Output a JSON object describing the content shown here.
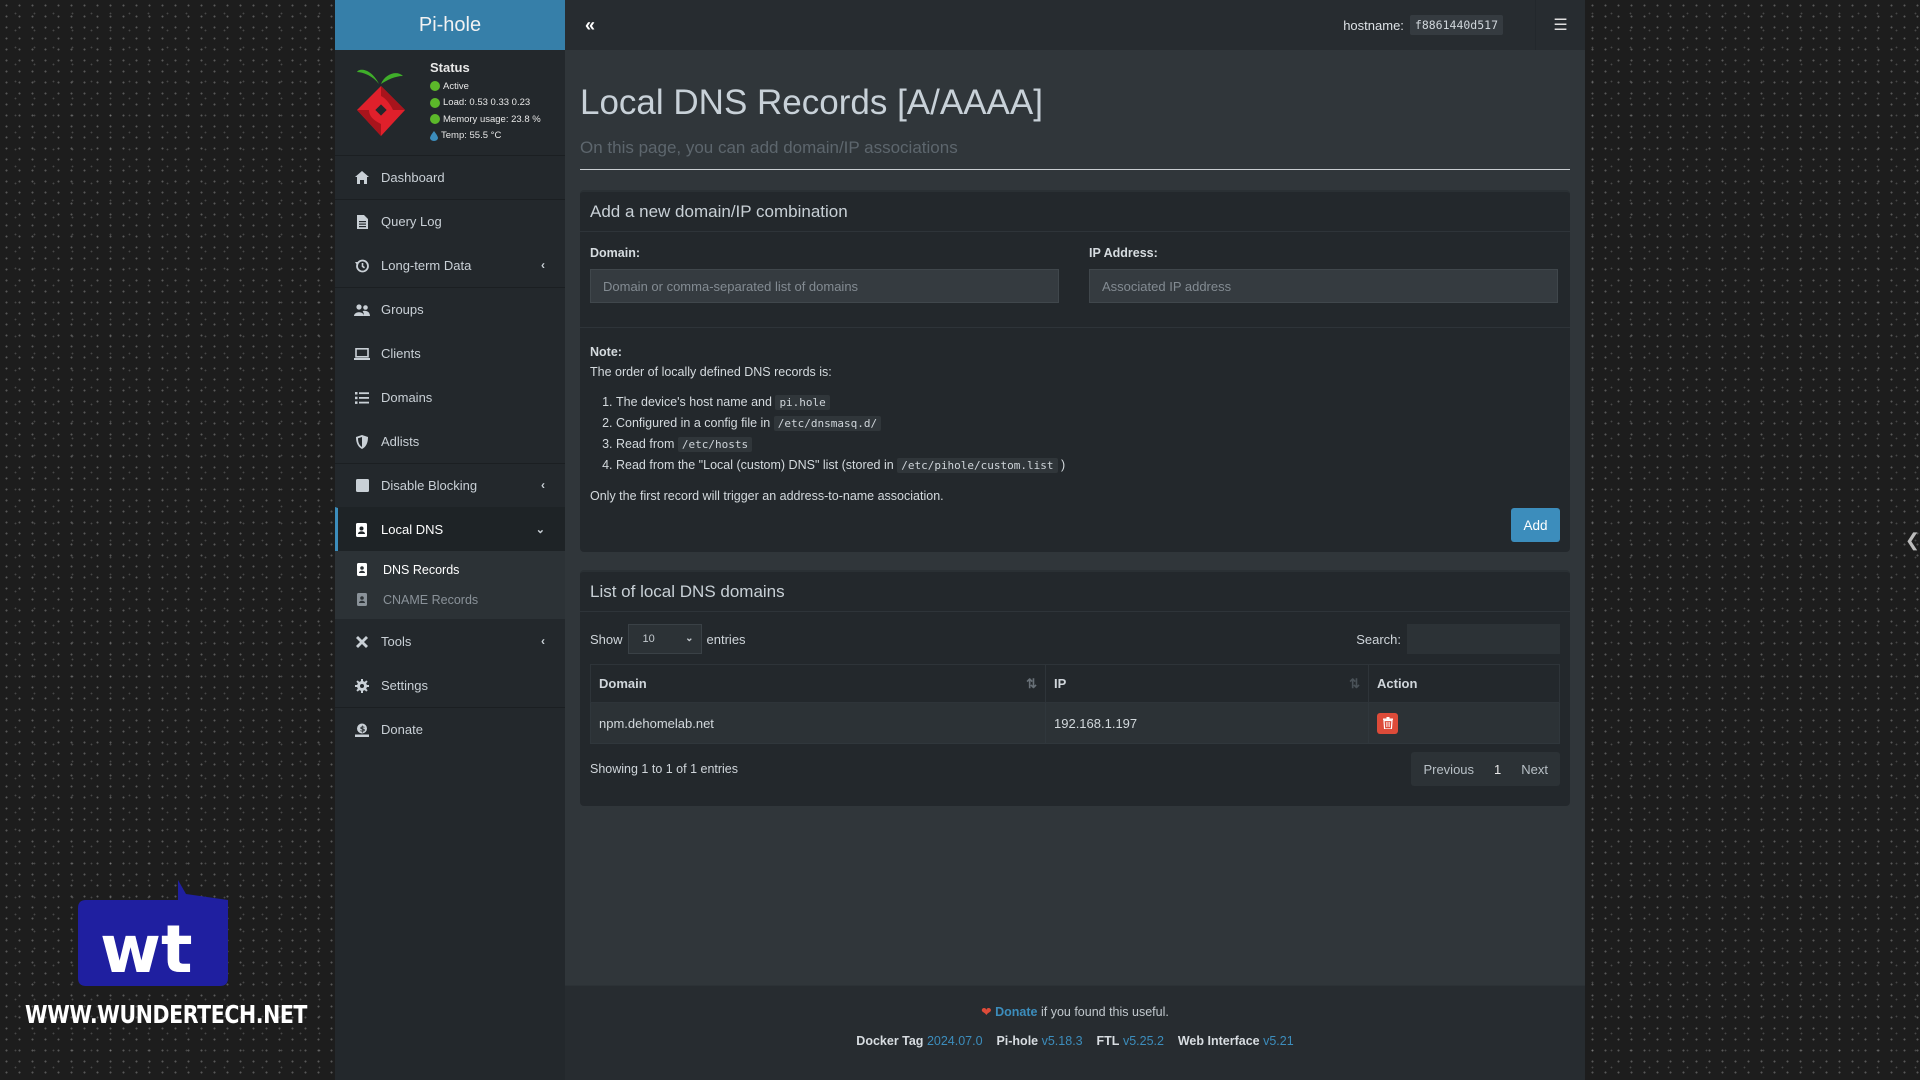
{
  "app": {
    "brand": "Pi-hole",
    "hostname_label": "hostname:",
    "hostname_value": "f8861440d517"
  },
  "status": {
    "title": "Status",
    "active": "Active",
    "load": "Load:  0.53  0.33  0.23",
    "memory": "Memory usage:  23.8 %",
    "temp": "Temp: 55.5 °C",
    "colors": {
      "ok": "#5cb82a",
      "temp": "#3c8dbc"
    }
  },
  "sidebar": {
    "items": [
      {
        "label": "Dashboard",
        "icon": "home-icon"
      },
      {
        "label": "Query Log",
        "icon": "file-icon"
      },
      {
        "label": "Long-term Data",
        "icon": "history-icon",
        "expandable": true
      },
      {
        "label": "Groups",
        "icon": "users-icon"
      },
      {
        "label": "Clients",
        "icon": "laptop-icon"
      },
      {
        "label": "Domains",
        "icon": "list-icon"
      },
      {
        "label": "Adlists",
        "icon": "shield-icon"
      },
      {
        "label": "Disable Blocking",
        "icon": "stop-icon",
        "expandable": true
      },
      {
        "label": "Local DNS",
        "icon": "address-book-icon",
        "expanded": true,
        "active": true
      },
      {
        "label": "Tools",
        "icon": "tools-icon",
        "expandable": true
      },
      {
        "label": "Settings",
        "icon": "gear-icon"
      },
      {
        "label": "Donate",
        "icon": "donate-icon"
      }
    ],
    "local_dns_sub": [
      {
        "label": "DNS Records",
        "active": true
      },
      {
        "label": "CNAME Records",
        "active": false
      }
    ]
  },
  "page": {
    "title": "Local DNS Records [A/AAAA]",
    "subtitle": "On this page, you can add domain/IP associations"
  },
  "add_box": {
    "title": "Add a new domain/IP combination",
    "domain_label": "Domain:",
    "domain_placeholder": "Domain or comma-separated list of domains",
    "domain_value": "",
    "ip_label": "IP Address:",
    "ip_placeholder": "Associated IP address",
    "ip_value": "",
    "note_title": "Note:",
    "note_intro": "The order of locally defined DNS records is:",
    "note_items": [
      {
        "text": "The device's host name and",
        "code": "pi.hole",
        "after": ""
      },
      {
        "text": "Configured in a config file in",
        "code": "/etc/dnsmasq.d/",
        "after": ""
      },
      {
        "text": "Read from",
        "code": "/etc/hosts",
        "after": ""
      },
      {
        "text": "Read from the \"Local (custom) DNS\" list (stored in",
        "code": "/etc/pihole/custom.list",
        "after": ")"
      }
    ],
    "note_last": "Only the first record will trigger an address-to-name association.",
    "add_label": "Add"
  },
  "list_box": {
    "title": "List of local DNS domains",
    "show_label": "Show",
    "entries_label": "entries",
    "page_size": "10",
    "search_label": "Search:",
    "search_value": "",
    "columns": [
      "Domain",
      "IP",
      "Action"
    ],
    "rows": [
      {
        "domain": "npm.dehomelab.net",
        "ip": "192.168.1.197"
      }
    ],
    "info": "Showing 1 to 1 of 1 entries",
    "pagination": {
      "previous": "Previous",
      "current": "1",
      "next": "Next"
    }
  },
  "footer": {
    "donate_link": "Donate",
    "donate_text": " if you found this useful.",
    "versions": [
      {
        "label": "Docker Tag",
        "value": "2024.07.0"
      },
      {
        "label": "Pi-hole",
        "value": "v5.18.3"
      },
      {
        "label": "FTL",
        "value": "v5.25.2"
      },
      {
        "label": "Web Interface",
        "value": "v5.21"
      }
    ]
  },
  "watermark": {
    "logo_text": "wt",
    "url": "WWW.WUNDERTECH.NET"
  },
  "colors": {
    "accent": "#3c8dbc",
    "brand_bar": "#367fa9",
    "danger": "#dd4b39"
  }
}
